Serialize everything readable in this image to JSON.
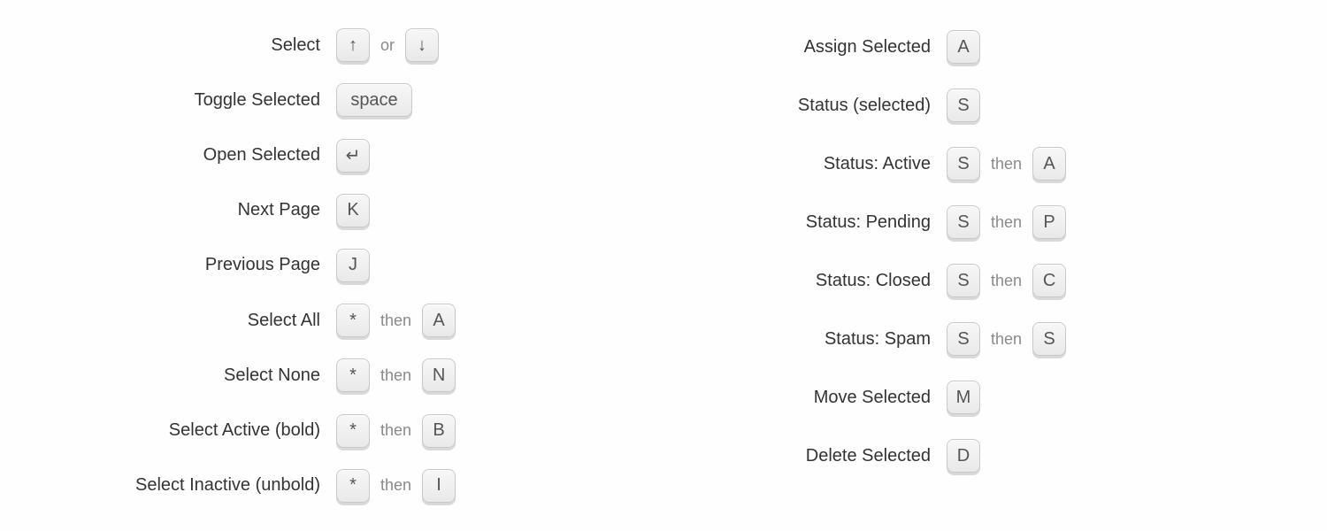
{
  "connectors": {
    "or": "or",
    "then": "then"
  },
  "keys": {
    "arrow_up": "↑",
    "arrow_down": "↓",
    "enter": "↵",
    "space": "space",
    "K": "K",
    "J": "J",
    "star": "*",
    "A": "A",
    "N": "N",
    "B": "B",
    "I": "I",
    "S": "S",
    "P": "P",
    "C": "C",
    "M": "M",
    "D": "D"
  },
  "left": [
    {
      "label": "Select",
      "seq": [
        {
          "t": "key",
          "k": "arrow_up"
        },
        {
          "t": "sep",
          "s": "or"
        },
        {
          "t": "key",
          "k": "arrow_down"
        }
      ]
    },
    {
      "label": "Toggle Selected",
      "seq": [
        {
          "t": "key",
          "k": "space",
          "wide": true
        }
      ]
    },
    {
      "label": "Open Selected",
      "seq": [
        {
          "t": "key",
          "k": "enter"
        }
      ]
    },
    {
      "label": "Next Page",
      "seq": [
        {
          "t": "key",
          "k": "K"
        }
      ]
    },
    {
      "label": "Previous Page",
      "seq": [
        {
          "t": "key",
          "k": "J"
        }
      ]
    },
    {
      "label": "Select All",
      "seq": [
        {
          "t": "key",
          "k": "star"
        },
        {
          "t": "sep",
          "s": "then"
        },
        {
          "t": "key",
          "k": "A"
        }
      ]
    },
    {
      "label": "Select None",
      "seq": [
        {
          "t": "key",
          "k": "star"
        },
        {
          "t": "sep",
          "s": "then"
        },
        {
          "t": "key",
          "k": "N"
        }
      ]
    },
    {
      "label": "Select Active (bold)",
      "seq": [
        {
          "t": "key",
          "k": "star"
        },
        {
          "t": "sep",
          "s": "then"
        },
        {
          "t": "key",
          "k": "B"
        }
      ]
    },
    {
      "label": "Select Inactive (unbold)",
      "seq": [
        {
          "t": "key",
          "k": "star"
        },
        {
          "t": "sep",
          "s": "then"
        },
        {
          "t": "key",
          "k": "I"
        }
      ]
    }
  ],
  "right": [
    {
      "label": "Assign Selected",
      "seq": [
        {
          "t": "key",
          "k": "A"
        }
      ]
    },
    {
      "label": "Status (selected)",
      "seq": [
        {
          "t": "key",
          "k": "S"
        }
      ]
    },
    {
      "label": "Status: Active",
      "seq": [
        {
          "t": "key",
          "k": "S"
        },
        {
          "t": "sep",
          "s": "then"
        },
        {
          "t": "key",
          "k": "A"
        }
      ]
    },
    {
      "label": "Status: Pending",
      "seq": [
        {
          "t": "key",
          "k": "S"
        },
        {
          "t": "sep",
          "s": "then"
        },
        {
          "t": "key",
          "k": "P"
        }
      ]
    },
    {
      "label": "Status: Closed",
      "seq": [
        {
          "t": "key",
          "k": "S"
        },
        {
          "t": "sep",
          "s": "then"
        },
        {
          "t": "key",
          "k": "C"
        }
      ]
    },
    {
      "label": "Status: Spam",
      "seq": [
        {
          "t": "key",
          "k": "S"
        },
        {
          "t": "sep",
          "s": "then"
        },
        {
          "t": "key",
          "k": "S"
        }
      ]
    },
    {
      "label": "Move Selected",
      "seq": [
        {
          "t": "key",
          "k": "M"
        }
      ]
    },
    {
      "label": "Delete Selected",
      "seq": [
        {
          "t": "key",
          "k": "D"
        }
      ]
    }
  ]
}
